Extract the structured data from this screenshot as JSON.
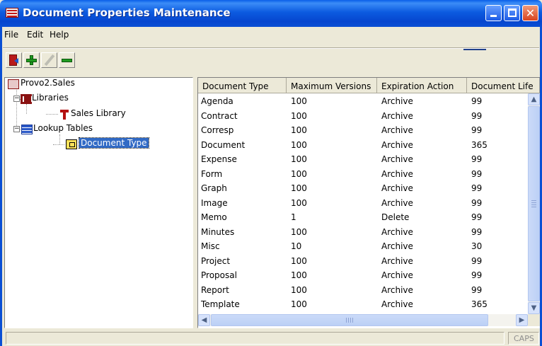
{
  "window": {
    "title": "Document Properties Maintenance"
  },
  "menu": {
    "file": "File",
    "edit": "Edit",
    "help": "Help"
  },
  "toolbar": {
    "exit_icon": "exit-door-icon",
    "add_icon": "green-plus-icon",
    "edit_icon": "pencil-icon",
    "delete_icon": "green-minus-icon"
  },
  "tree": {
    "root": "Provo2.Sales",
    "libraries": "Libraries",
    "sales_library": "Sales Library",
    "lookup_tables": "Lookup Tables",
    "document_type": "Document Type"
  },
  "grid": {
    "headers": [
      "Document Type",
      "Maximum Versions",
      "Expiration Action",
      "Document Life"
    ],
    "rows": [
      [
        "Agenda",
        "100",
        "Archive",
        "99"
      ],
      [
        "Contract",
        "100",
        "Archive",
        "99"
      ],
      [
        "Corresp",
        "100",
        "Archive",
        "99"
      ],
      [
        "Document",
        "100",
        "Archive",
        "365"
      ],
      [
        "Expense",
        "100",
        "Archive",
        "99"
      ],
      [
        "Form",
        "100",
        "Archive",
        "99"
      ],
      [
        "Graph",
        "100",
        "Archive",
        "99"
      ],
      [
        "Image",
        "100",
        "Archive",
        "99"
      ],
      [
        "Memo",
        "1",
        "Delete",
        "99"
      ],
      [
        "Minutes",
        "100",
        "Archive",
        "99"
      ],
      [
        "Misc",
        "10",
        "Archive",
        "30"
      ],
      [
        "Project",
        "100",
        "Archive",
        "99"
      ],
      [
        "Proposal",
        "100",
        "Archive",
        "99"
      ],
      [
        "Report",
        "100",
        "Archive",
        "99"
      ],
      [
        "Template",
        "100",
        "Archive",
        "365"
      ]
    ]
  },
  "status": {
    "caps": "CAPS"
  }
}
